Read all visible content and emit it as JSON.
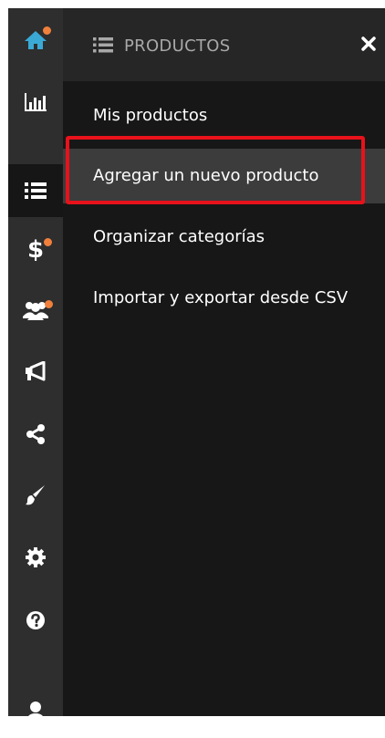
{
  "rail": {
    "items": [
      {
        "icon": "home-icon",
        "badge": true
      },
      {
        "icon": "bar-chart-icon",
        "badge": false
      },
      {
        "icon": "list-icon",
        "badge": false,
        "active": true
      },
      {
        "icon": "dollar-icon",
        "badge": true
      },
      {
        "icon": "users-icon",
        "badge": true
      },
      {
        "icon": "megaphone-icon",
        "badge": false
      },
      {
        "icon": "share-icon",
        "badge": false
      },
      {
        "icon": "brush-icon",
        "badge": false
      },
      {
        "icon": "gear-icon",
        "badge": false
      },
      {
        "icon": "help-icon",
        "badge": false
      },
      {
        "icon": "user-icon",
        "badge": false
      }
    ],
    "dollar_glyph": "$"
  },
  "panel": {
    "title": "PRODUCTOS",
    "close_glyph": "✖",
    "items": [
      {
        "label": "Mis productos"
      },
      {
        "label": "Agregar un nuevo producto",
        "selected": true
      },
      {
        "label": "Organizar categorías"
      },
      {
        "label": "Importar y exportar desde CSV"
      }
    ]
  },
  "colors": {
    "rail_bg": "#2e2e2e",
    "panel_bg": "#171717",
    "header_bg": "#262626",
    "selected_bg": "#3c3c3c",
    "badge": "#f0803c",
    "highlight_border": "#e8121b",
    "home_icon": "#3aa9d6"
  }
}
